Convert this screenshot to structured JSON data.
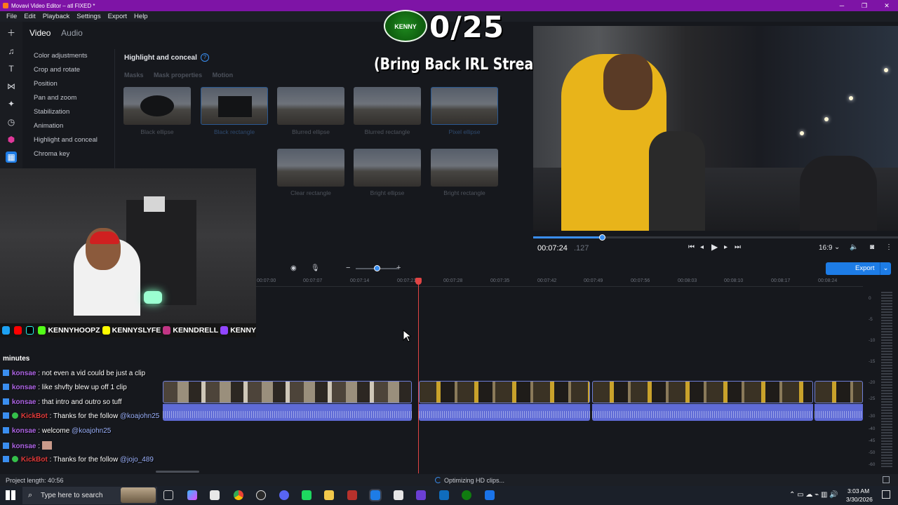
{
  "window": {
    "title": "Movavi Video Editor – atl FIXED *",
    "controls": [
      "─",
      "❐",
      "✕"
    ]
  },
  "menu": [
    "File",
    "Edit",
    "Playback",
    "Settings",
    "Export",
    "Help"
  ],
  "tabs": {
    "video": "Video",
    "audio": "Audio"
  },
  "filters": [
    "Color adjustments",
    "Crop and rotate",
    "Position",
    "Pan and zoom",
    "Stabilization",
    "Animation",
    "Highlight and conceal",
    "Chroma key"
  ],
  "panel": {
    "title": "Highlight and conceal",
    "help": "?",
    "subtabs": [
      "Masks",
      "Mask properties",
      "Motion"
    ],
    "presets_row1": [
      "Black ellipse",
      "Black rectangle",
      "Blurred ellipse",
      "Blurred rectangle",
      "Pixel ellipse"
    ],
    "presets_row2": [
      "Clear rectangle",
      "Bright ellipse",
      "Bright rectangle"
    ]
  },
  "overlay": {
    "logo": "KENNY",
    "counter": "0/25",
    "subtitle": "(Bring Back IRL Streams)"
  },
  "player": {
    "timecode": "00:07:24",
    "timecode_ms": ".127",
    "aspect": "16:9",
    "progress_fraction": 0.19
  },
  "timeline": {
    "ruler": [
      "00:07:00",
      "00:07:07",
      "00:07:14",
      "00:07:21",
      "00:07:28",
      "00:07:35",
      "00:07:42",
      "00:07:49",
      "00:07:56",
      "00:08:03",
      "00:08:10",
      "00:08:17",
      "00:08:24"
    ],
    "export_label": "Export",
    "db_scale": [
      "0",
      "-5",
      "-10",
      "-15",
      "-20",
      "-25",
      "-30",
      "-40",
      "-45",
      "-50",
      "-60"
    ]
  },
  "webcam": {
    "social": [
      "KENNYHOOPZ",
      "KENNYSLYFE",
      "KENNDRELL",
      "KENNY"
    ]
  },
  "chat": {
    "header": "minutes",
    "lines": [
      {
        "user": "konsae",
        "text": ": not even a vid could be just a clip",
        "mention": "",
        "bot": false
      },
      {
        "user": "konsae",
        "text": ": like shvfty blew up off 1 clip",
        "mention": "",
        "bot": false
      },
      {
        "user": "konsae",
        "text": ": that intro and outro so tuff",
        "mention": "",
        "bot": false
      },
      {
        "user": "KickBot",
        "text": ": Thanks for the follow",
        "mention": "@koajohn25",
        "bot": true
      },
      {
        "user": "konsae",
        "text": ": welcome",
        "mention": "@koajohn25",
        "bot": false
      },
      {
        "user": "konsae",
        "text": ":",
        "mention": "",
        "bot": false
      },
      {
        "user": "KickBot",
        "text": ": Thanks for the follow",
        "mention": "@jojo_489",
        "bot": true
      }
    ]
  },
  "status": {
    "project_length": "Project length: 40:56",
    "message": "Optimizing HD clips..."
  },
  "taskbar": {
    "search_placeholder": "Type here to search",
    "time": "3:03 AM",
    "date": "3/30/2026"
  }
}
